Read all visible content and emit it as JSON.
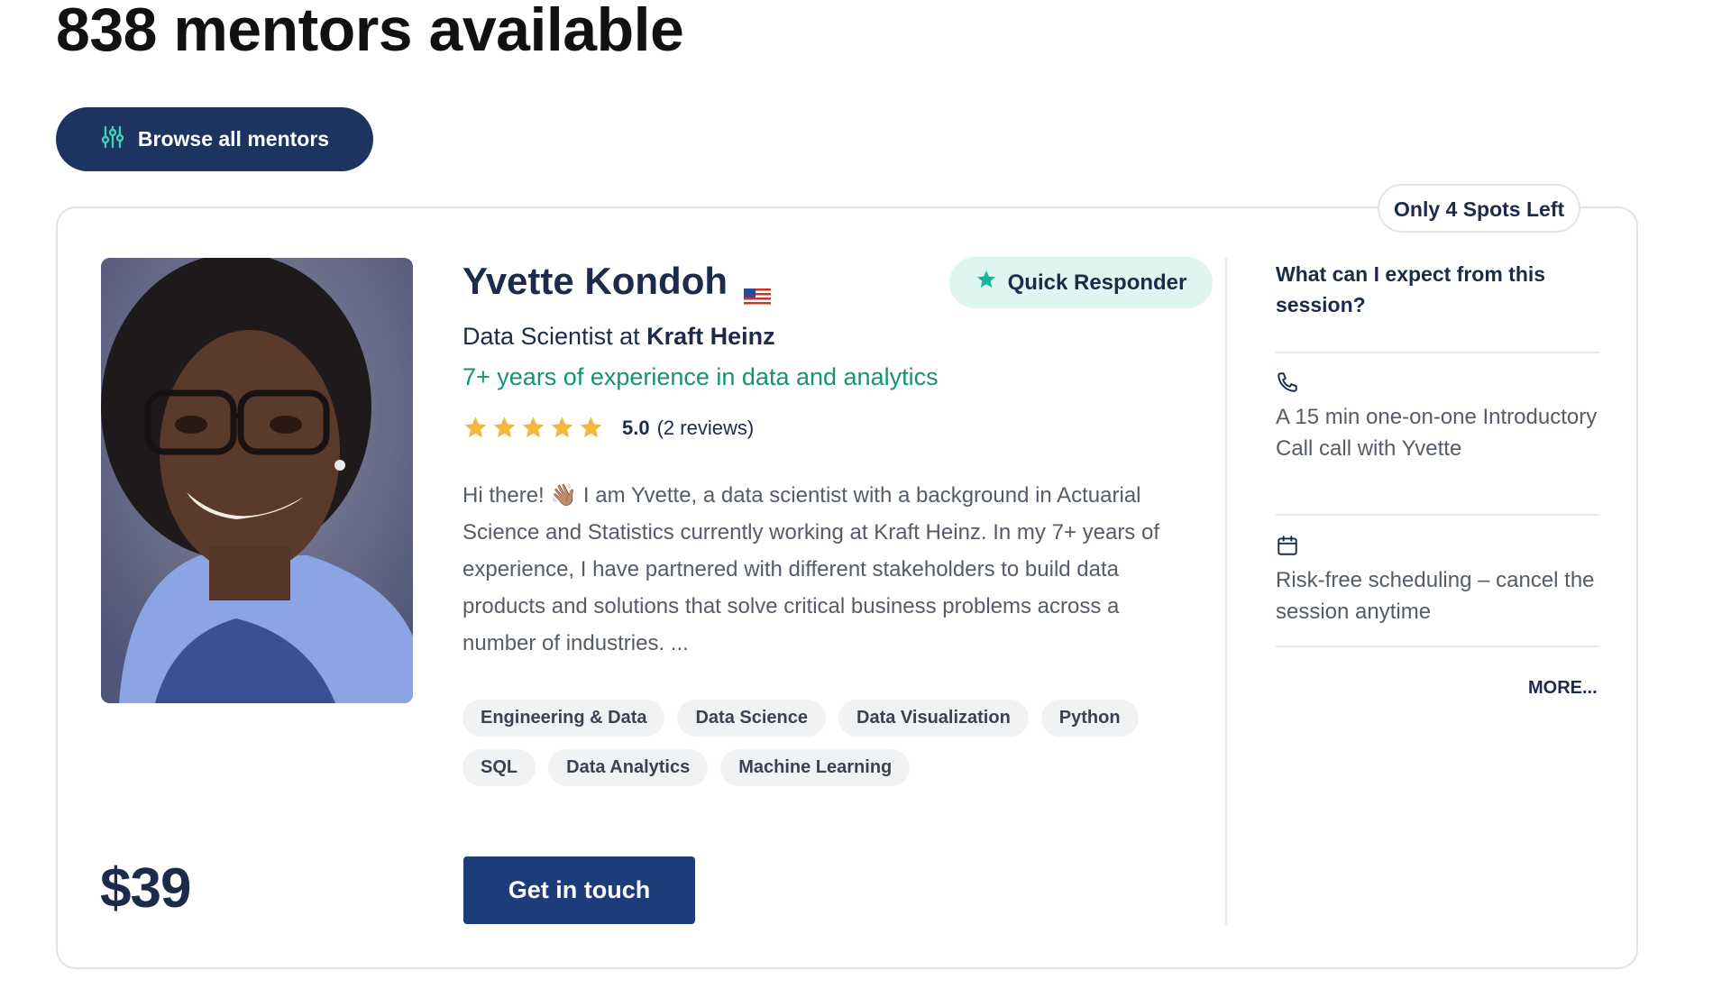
{
  "header": {
    "title": "838 mentors available",
    "browse_button": "Browse all mentors"
  },
  "card": {
    "spots_badge": "Only 4 Spots Left",
    "mentor": {
      "name": "Yvette Kondoh",
      "flag": "us-flag-icon",
      "quick_badge": "Quick Responder",
      "job_prefix": "Data Scientist at",
      "company": "Kraft Heinz",
      "experience": "7+ years of experience in data and analytics",
      "rating": {
        "stars": 5,
        "value": "5.0",
        "reviews": "(2 reviews)"
      },
      "bio": "Hi there! 👋🏽 I am Yvette, a data scientist with a background in Actuarial Science and Statistics currently working at Kraft Heinz. In my 7+ years of experience, I have partnered with different stakeholders to build data products and solutions that solve critical business problems across a number of industries. ...",
      "tags": [
        "Engineering & Data",
        "Data Science",
        "Data Visualization",
        "Python",
        "SQL",
        "Data Analytics",
        "Machine Learning"
      ]
    },
    "price": "$39",
    "cta": "Get in touch",
    "expect": {
      "title": "What can I expect from this session?",
      "features": [
        {
          "icon": "phone-icon",
          "text": "A 15 min one-on-one Introductory Call call with Yvette"
        },
        {
          "icon": "calendar-icon",
          "text": "Risk-free scheduling – cancel the session anytime"
        }
      ],
      "more": "MORE..."
    }
  },
  "colors": {
    "navy": "#1d3461",
    "teal_text": "#159275",
    "quick_badge_bg": "#dff5ef",
    "star": "#f4b63f"
  }
}
